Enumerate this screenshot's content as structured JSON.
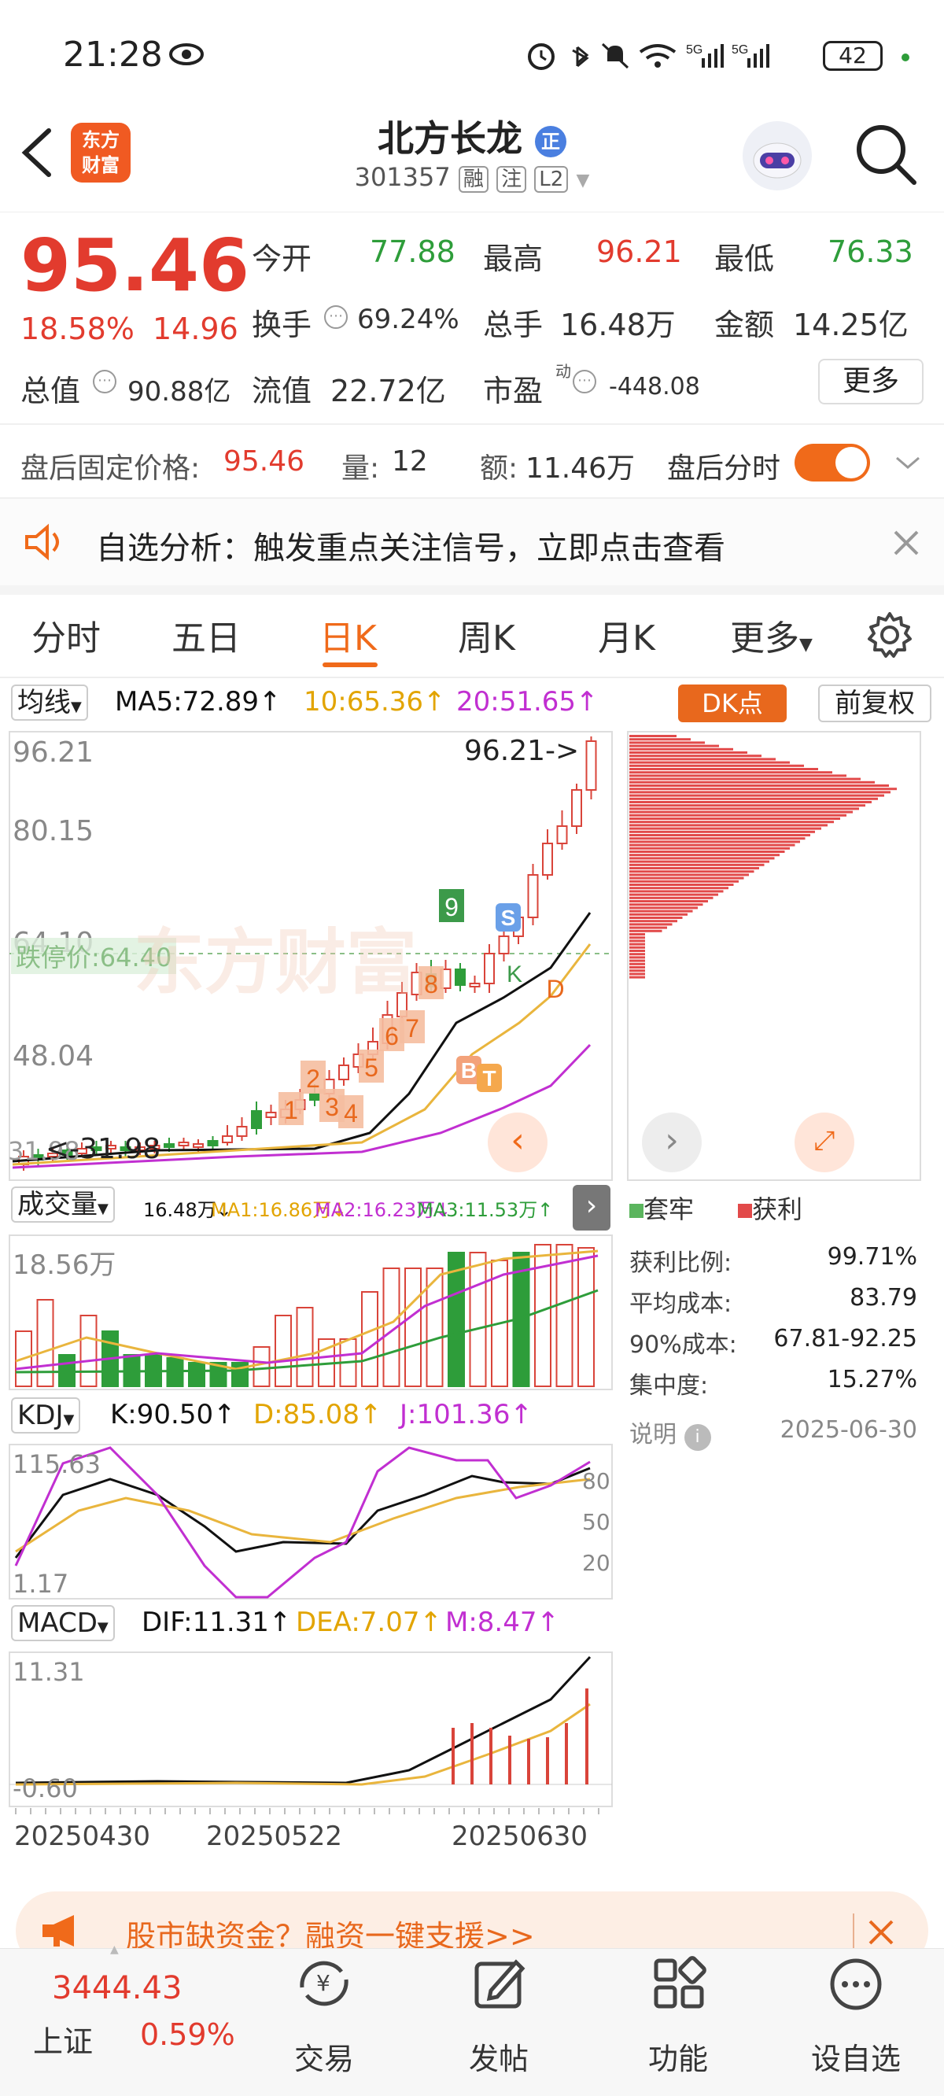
{
  "status_bar": {
    "time": "21:28",
    "battery": "42",
    "network1": "5G",
    "network2": "5G"
  },
  "header": {
    "app_logo_line1": "东方",
    "app_logo_line2": "财富",
    "stock_name": "北方长龙",
    "name_badge": "正",
    "stock_code": "301357",
    "tag1": "融",
    "tag2": "注",
    "tag3": "L2"
  },
  "quote": {
    "price": "95.46",
    "change_pct": "18.58%",
    "change_abs": "14.96",
    "open_label": "今开",
    "open": "77.88",
    "high_label": "最高",
    "high": "96.21",
    "low_label": "最低",
    "low": "76.33",
    "turnover_label": "换手",
    "turnover": "69.24%",
    "volume_label": "总手",
    "volume": "16.48万",
    "amount_label": "金额",
    "amount": "14.25亿",
    "mktcap_label": "总值",
    "mktcap": "90.88亿",
    "float_label": "流值",
    "float_cap": "22.72亿",
    "pe_label": "市盈",
    "pe_superscript": "动",
    "pe": "-448.08",
    "more_button": "更多"
  },
  "after_hours": {
    "price_label": "盘后固定价格:",
    "price": "95.46",
    "volume_label": "量:",
    "volume": "12",
    "amount_label": "额:",
    "amount": "11.46万",
    "toggle_label": "盘后分时",
    "toggle_on": true
  },
  "notice": {
    "text": "自选分析：触发重点关注信号，立即点击查看"
  },
  "tabs": {
    "items": [
      "分时",
      "五日",
      "日K",
      "周K",
      "月K",
      "更多"
    ],
    "active": "日K"
  },
  "ma_bar": {
    "selector": "均线",
    "ma5": "MA5:72.89↑",
    "ma10": "10:65.36↑",
    "ma20": "20:51.65↑",
    "dk_button": "DK点",
    "adjust_button": "前复权"
  },
  "kchart": {
    "y_labels": [
      "96.21",
      "80.15",
      "64.10",
      "48.04"
    ],
    "max_marker": "96.21->",
    "limit_down_label": "跌停价:64.40",
    "min_marker": "<-31.98",
    "min_prefix": "31.98",
    "watermark": "东方财富",
    "signals": [
      "1",
      "2",
      "3",
      "4",
      "5",
      "6",
      "7",
      "8",
      "9"
    ],
    "badges": [
      "B",
      "T",
      "S",
      "K",
      "D"
    ]
  },
  "chip": {
    "legend_trapped": "套牢",
    "legend_profit": "获利",
    "profit_ratio_label": "获利比例:",
    "profit_ratio": "99.71%",
    "avg_cost_label": "平均成本:",
    "avg_cost": "83.79",
    "cost90_label": "90%成本:",
    "cost90": "67.81-92.25",
    "concentration_label": "集中度:",
    "concentration": "15.27%",
    "note_label": "说明",
    "date": "2025-06-30"
  },
  "volume_bar": {
    "selector": "成交量",
    "vol": "16.48万↓",
    "ma1": "MA1:16.86万↓",
    "ma2": "MA2:16.23万↓",
    "ma3": "MA3:11.53万↑",
    "y_label": "18.56万"
  },
  "kdj_bar": {
    "selector": "KDJ",
    "k": "K:90.50↑",
    "d": "D:85.08↑",
    "j": "J:101.36↑",
    "y_top": "115.63",
    "y_bottom": "1.17",
    "levels": [
      "80",
      "50",
      "20"
    ]
  },
  "macd_bar": {
    "selector": "MACD",
    "dif": "DIF:11.31↑",
    "dea": "DEA:7.07↑",
    "m": "M:8.47↑",
    "y_top": "11.31",
    "y_bottom": "-0.60"
  },
  "x_axis": {
    "dates": [
      "20250430",
      "20250522",
      "20250630"
    ]
  },
  "promo": {
    "text": "股市缺资金？融资一键支援>>"
  },
  "bottom_nav": {
    "index_value": "3444.43",
    "index_name": "上证",
    "index_change": "0.59%",
    "items": [
      "交易",
      "发帖",
      "功能",
      "设自选"
    ]
  },
  "colors": {
    "up": "#e23b2e",
    "down": "#2e9d3a",
    "accent": "#e8681d",
    "ma5": "#111111",
    "ma10": "#e9b53d",
    "ma20": "#c12fd1"
  }
}
